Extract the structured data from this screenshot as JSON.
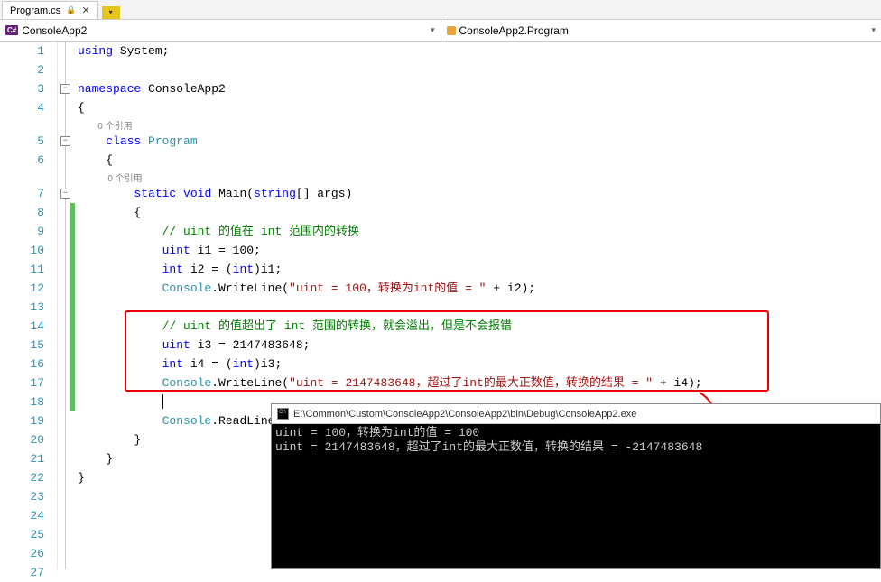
{
  "tab": {
    "filename": "Program.cs",
    "locked": true
  },
  "breadcrumb": {
    "left": "ConsoleApp2",
    "right": "ConsoleApp2.Program"
  },
  "gutter": {
    "lines": [
      "1",
      "2",
      "3",
      "4",
      "5",
      "6",
      "7",
      "8",
      "9",
      "10",
      "11",
      "12",
      "13",
      "14",
      "15",
      "16",
      "17",
      "18",
      "19",
      "20",
      "21",
      "22",
      "23",
      "24",
      "25",
      "26",
      "27"
    ]
  },
  "refs": {
    "zero_refs": "0 个引用"
  },
  "code": {
    "l1_using": "using",
    "l1_system": " System;",
    "l3_ns": "namespace",
    "l3_name": " ConsoleApp2",
    "l4": "{",
    "l5_class": "class",
    "l5_type": " Program",
    "l6": "    {",
    "l7_static": "static",
    "l7_void": "void",
    "l7_main": " Main(",
    "l7_string": "string",
    "l7_args": "[] args)",
    "l8": "        {",
    "l9_comment": "// uint 的值在 int 范围内的转换",
    "l10_uint": "uint",
    "l10_rest": " i1 = 100;",
    "l11_int": "int",
    "l11_rest": " i2 = (",
    "l11_cast": "int",
    "l11_tail": ")i1;",
    "l12_console": "Console",
    "l12_wl": ".WriteLine(",
    "l12_str": "\"uint = 100，转换为int的值 = \"",
    "l12_tail": " + i2);",
    "l14_comment": "// uint 的值超出了 int 范围的转换，就会溢出，但是不会报错",
    "l15_uint": "uint",
    "l15_rest": " i3 = 2147483648;",
    "l16_int": "int",
    "l16_rest": " i4 = (",
    "l16_cast": "int",
    "l16_tail": ")i3;",
    "l17_console": "Console",
    "l17_wl": ".WriteLine(",
    "l17_str": "\"uint = 2147483648，超过了int的最大正数值，转换的结果 = \"",
    "l17_tail": " + i4);",
    "l19_console": "Console",
    "l19_rl": ".ReadLine();",
    "l20": "        }",
    "l21": "    }",
    "l22": "}"
  },
  "console": {
    "title": "E:\\Common\\Custom\\ConsoleApp2\\ConsoleApp2\\bin\\Debug\\ConsoleApp2.exe",
    "line1": "uint = 100，转换为int的值 = 100",
    "line2": "uint = 2147483648，超过了int的最大正数值，转换的结果 = -2147483648"
  }
}
